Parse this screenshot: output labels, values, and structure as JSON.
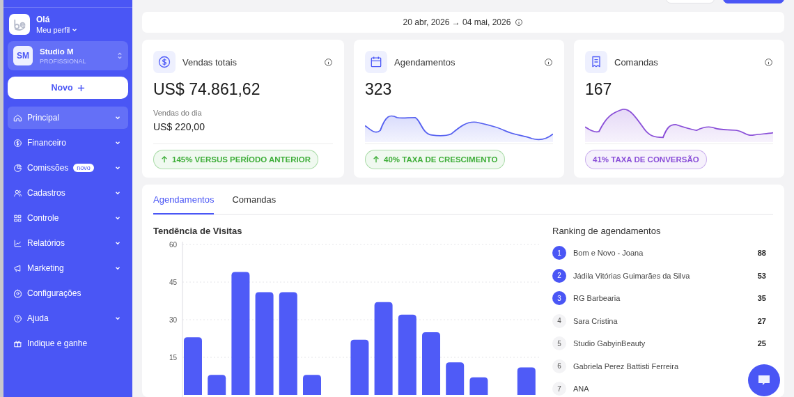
{
  "sidebar": {
    "greeting": "Olá",
    "profile_link": "Meu perfil",
    "account": {
      "initials": "SM",
      "name": "Studio M",
      "plan": "PROFISSIONAL"
    },
    "new_button": "Novo",
    "items": [
      {
        "label": "Principal",
        "selected": true,
        "expandable": true
      },
      {
        "label": "Financeiro",
        "selected": false,
        "expandable": true
      },
      {
        "label": "Comissões",
        "badge": "novo",
        "selected": false,
        "expandable": true
      },
      {
        "label": "Cadastros",
        "selected": false,
        "expandable": true
      },
      {
        "label": "Controle",
        "selected": false,
        "expandable": true
      },
      {
        "label": "Relatórios",
        "selected": false,
        "expandable": true
      },
      {
        "label": "Marketing",
        "selected": false,
        "expandable": true
      },
      {
        "label": "Configurações",
        "selected": false,
        "expandable": false
      },
      {
        "label": "Ajuda",
        "selected": false,
        "expandable": true
      },
      {
        "label": "Indique e ganhe",
        "selected": false,
        "expandable": false
      }
    ]
  },
  "date_range": "20 abr, 2026 → 04 mai, 2026",
  "cards": [
    {
      "title": "Vendas totais",
      "value": "US$ 74.861,62",
      "kind": "detail",
      "detail_label": "Vendas do dia",
      "detail_value": "US$ 220,00",
      "pill": "145% VERSUS PERÍODO ANTERIOR",
      "pill_arrow": true,
      "color": "#3fae3a"
    },
    {
      "title": "Agendamentos",
      "value": "323",
      "kind": "sparkline",
      "pill": "40% TAXA DE CRESCIMENTO",
      "pill_arrow": true,
      "color": "#3fae3a"
    },
    {
      "title": "Comandas",
      "value": "167",
      "kind": "sparkline",
      "pill": "41% TAXA DE CONVERSÃO",
      "pill_arrow": false,
      "color": "#8a4fd8"
    }
  ],
  "tabs": [
    {
      "label": "Agendamentos",
      "selected": true
    },
    {
      "label": "Comandas",
      "selected": false
    }
  ],
  "chart": {
    "title": "Tendência de Visitas",
    "chart_data": {
      "type": "bar",
      "grid": true,
      "values": [
        23,
        8,
        49,
        41,
        41,
        8,
        0,
        22,
        37,
        32,
        25,
        13,
        7,
        0,
        11
      ],
      "ylim": [
        0,
        60
      ],
      "yticks": [
        15,
        30,
        45,
        60
      ]
    }
  },
  "ranking": {
    "title": "Ranking de agendamentos",
    "items": [
      {
        "rank": "1",
        "name": "Bom e Novo - Joana",
        "count": "88",
        "kind": "top"
      },
      {
        "rank": "2",
        "name": "Jádila Vitórias Guimarães da Silva",
        "count": "53",
        "kind": "top"
      },
      {
        "rank": "3",
        "name": "RG Barbearia",
        "count": "35",
        "kind": "top"
      },
      {
        "rank": "4",
        "name": "Sara Cristina",
        "count": "27",
        "kind": "regular"
      },
      {
        "rank": "5",
        "name": "Studio GabyinBeauty",
        "count": "25",
        "kind": "regular"
      },
      {
        "rank": "6",
        "name": "Gabriela Perez Battisti Ferreira",
        "kind": "regular"
      },
      {
        "rank": "7",
        "name": "ANA",
        "kind": "regular"
      }
    ]
  }
}
